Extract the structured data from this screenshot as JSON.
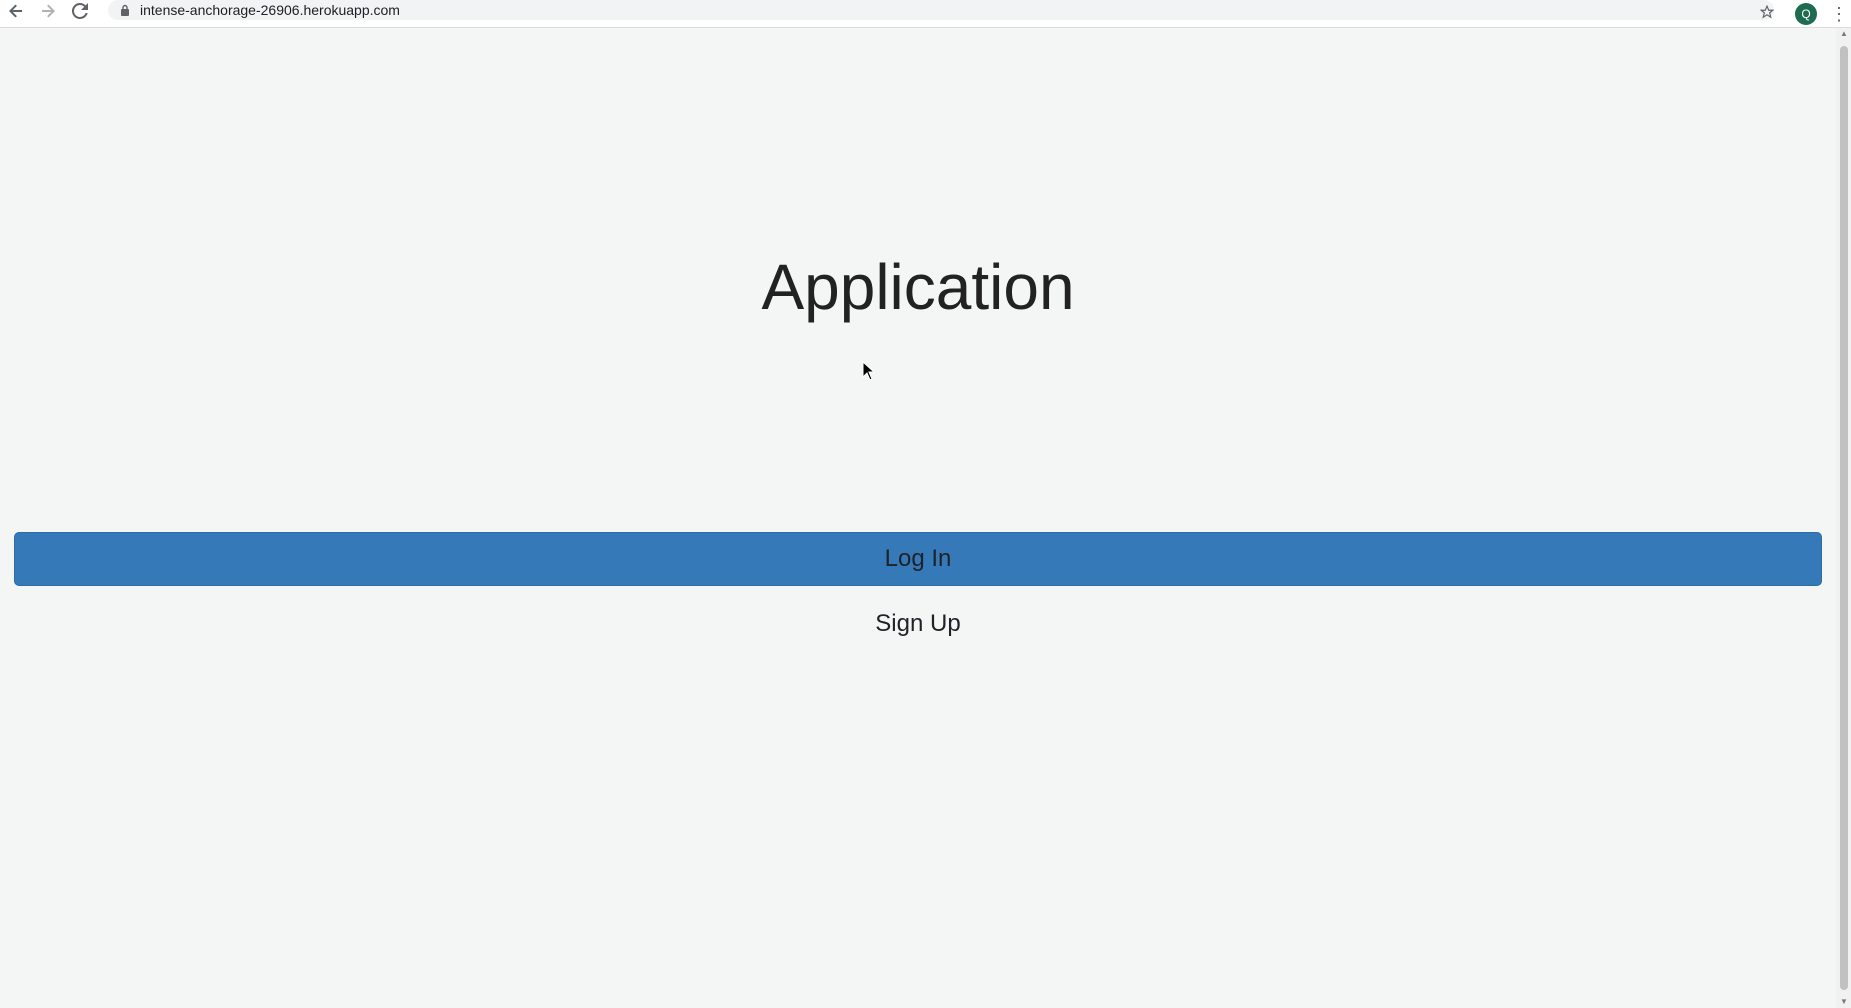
{
  "browser": {
    "url": "intense-anchorage-26906.herokuapp.com",
    "profile_initial": "Q"
  },
  "page": {
    "title": "Application",
    "login_label": "Log In",
    "signup_label": "Sign Up"
  },
  "icons": {
    "back": "back-arrow-icon",
    "forward": "forward-arrow-icon",
    "reload": "reload-icon",
    "lock": "lock-icon",
    "star": "star-icon",
    "menu": "kebab-menu-icon",
    "cursor": "mouse-pointer-icon"
  },
  "colors": {
    "page_background": "#f4f6f5",
    "primary_button": "#3579b8",
    "avatar": "#1e6b4f"
  }
}
